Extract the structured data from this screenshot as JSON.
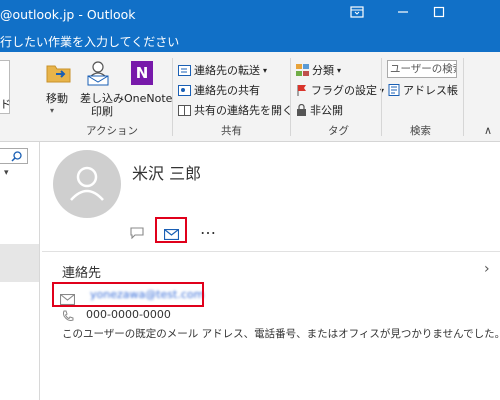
{
  "window": {
    "title": "@outlook.jp  -  Outlook",
    "controls": {
      "ribbon_options": "ribbon-display-icon",
      "minimize": "minimize-icon",
      "maximize": "maximize-icon"
    }
  },
  "tell_me": {
    "text": "行したい作業を入力してください"
  },
  "left_pane": {
    "partial_label": "ド"
  },
  "ribbon": {
    "action_group": {
      "label": "アクション",
      "move": "移動",
      "insert_print_1": "差し込み",
      "insert_print_2": "印刷",
      "onenote": "OneNote"
    },
    "share_group": {
      "label": "共有",
      "forward_contact": "連絡先の転送",
      "share_contact": "連絡先の共有",
      "open_shared": "共有の連絡先を開く"
    },
    "tags_group": {
      "label": "タグ",
      "categorize": "分類",
      "follow_up": "フラグの設定",
      "private": "非公開"
    },
    "search_group": {
      "label": "検索",
      "search_people_placeholder": "ユーザーの検索",
      "address_book": "アドレス帳"
    }
  },
  "contact": {
    "name": "米沢 三郎",
    "more_label": "…",
    "section_title": "連絡先",
    "email": "yonezawa@test.com",
    "phone": "000-0000-0000",
    "note": "このユーザーの既定のメール アドレス、電話番号、またはオフィスが見つかりませんでした。"
  },
  "colors": {
    "accent": "#1170c7",
    "highlight": "#e0001b"
  }
}
